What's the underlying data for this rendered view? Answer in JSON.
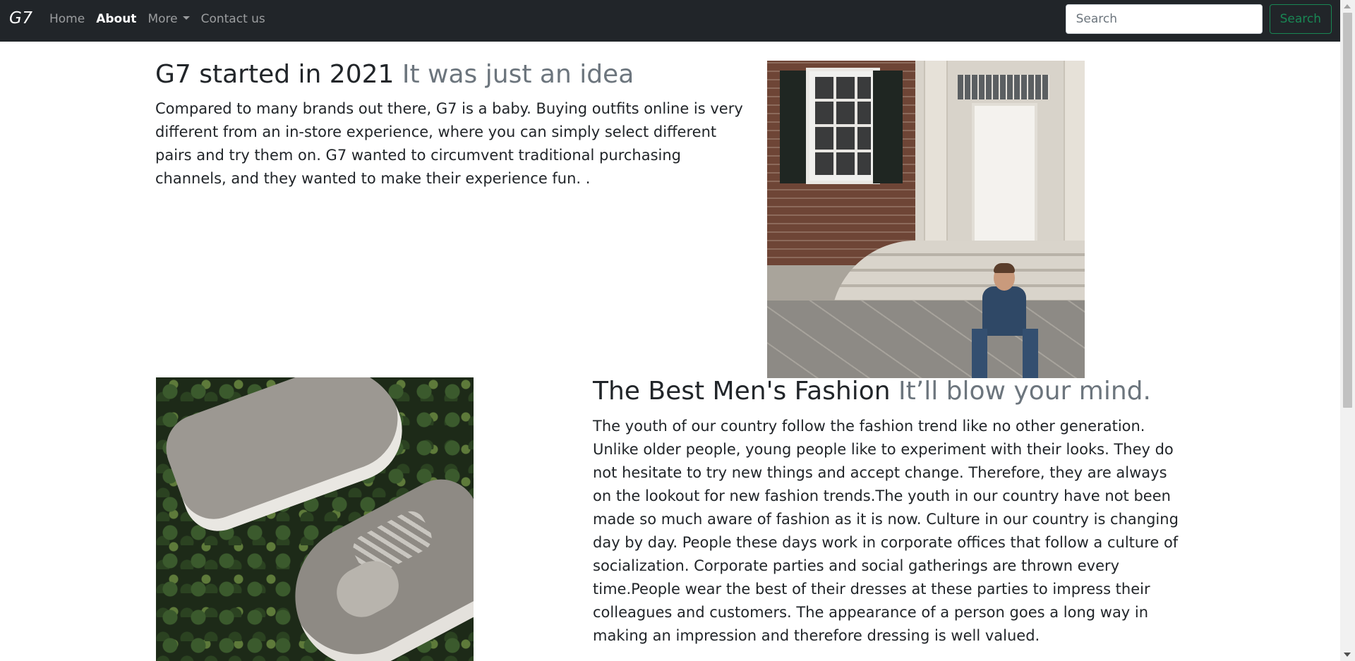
{
  "navbar": {
    "brand": "G7",
    "links": [
      {
        "label": "Home"
      },
      {
        "label": "About"
      },
      {
        "label": "More"
      },
      {
        "label": "Contact us"
      }
    ],
    "search_placeholder": "Search",
    "search_button": "Search"
  },
  "section1": {
    "heading": "G7 started in 2021",
    "heading_muted": "It was just an idea",
    "body": "Compared to many brands out there, G7 is a baby. Buying outfits online is very different from an in-store experience, where you can simply select different pairs and try them on. G7 wanted to circumvent traditional purchasing channels, and they wanted to make their experience fun. ."
  },
  "section2": {
    "heading": "The Best Men's Fashion",
    "heading_muted": "It’ll blow your mind.",
    "body": "The youth of our country follow the fashion trend like no other generation. Unlike older people, young people like to experiment with their looks. They do not hesitate to try new things and accept change. Therefore, they are always on the lookout for new fashion trends.The youth in our country have not been made so much aware of fashion as it is now. Culture in our country is changing day by day. People these days work in corporate offices that follow a culture of socialization. Corporate parties and social gatherings are thrown every time.People wear the best of their dresses at these parties to impress their colleagues and customers. The appearance of a person goes a long way in making an impression and therefore dressing is well valued."
  },
  "colors": {
    "navbar_bg": "#212529",
    "muted_text": "#6c757d",
    "search_button": "#198754"
  }
}
